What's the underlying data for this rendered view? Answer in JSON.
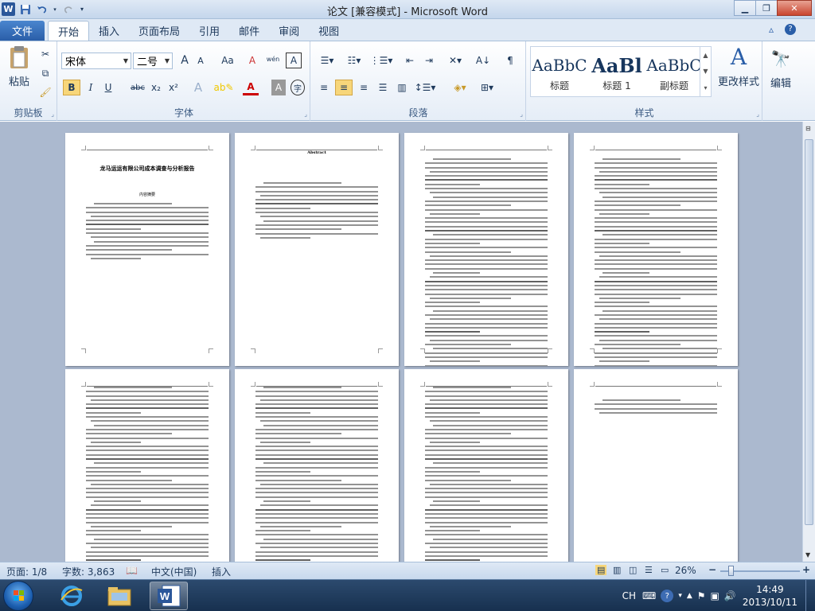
{
  "window": {
    "title": "论文 [兼容模式] - Microsoft Word"
  },
  "quick_access": {
    "app_icon": "W"
  },
  "tabs": {
    "file": "文件",
    "items": [
      "开始",
      "插入",
      "页面布局",
      "引用",
      "邮件",
      "审阅",
      "视图"
    ],
    "active": "开始"
  },
  "ribbon": {
    "clipboard": {
      "label": "剪贴板",
      "paste": "粘贴"
    },
    "font": {
      "label": "字体",
      "font_name": "宋体",
      "font_size": "二号",
      "bold": "B",
      "italic": "I",
      "underline": "U",
      "strike": "abc",
      "sub": "x₂",
      "sup": "x²",
      "grow": "A",
      "shrink": "A",
      "case": "Aa",
      "clear": "A",
      "pinyin": "wén",
      "border": "A"
    },
    "paragraph": {
      "label": "段落"
    },
    "styles": {
      "label": "样式",
      "items": [
        {
          "preview": "AaBbC",
          "name": "标题"
        },
        {
          "preview": "AaBl",
          "name": "标题 1"
        },
        {
          "preview": "AaBbC",
          "name": "副标题"
        }
      ],
      "change": "更改样式"
    },
    "editing": {
      "label": "编辑"
    }
  },
  "pages": [
    {
      "title": "龙马运运有限公司成本调查与分析报告",
      "subtitle": "内容摘要"
    },
    {
      "title": "Abstract",
      "subtitle": ""
    },
    {
      "title": "",
      "subtitle": ""
    },
    {
      "title": "",
      "subtitle": ""
    },
    {
      "title": "",
      "subtitle": ""
    },
    {
      "title": "",
      "subtitle": ""
    },
    {
      "title": "",
      "subtitle": ""
    },
    {
      "title": "",
      "subtitle": ""
    }
  ],
  "status": {
    "page": "页面: 1/8",
    "words": "字数: 3,863",
    "language": "中文(中国)",
    "mode": "插入",
    "zoom": "26%",
    "zoom_minus": "−",
    "zoom_plus": "+"
  },
  "taskbar": {
    "ime": "CH",
    "time": "14:49",
    "date": "2013/10/11"
  }
}
